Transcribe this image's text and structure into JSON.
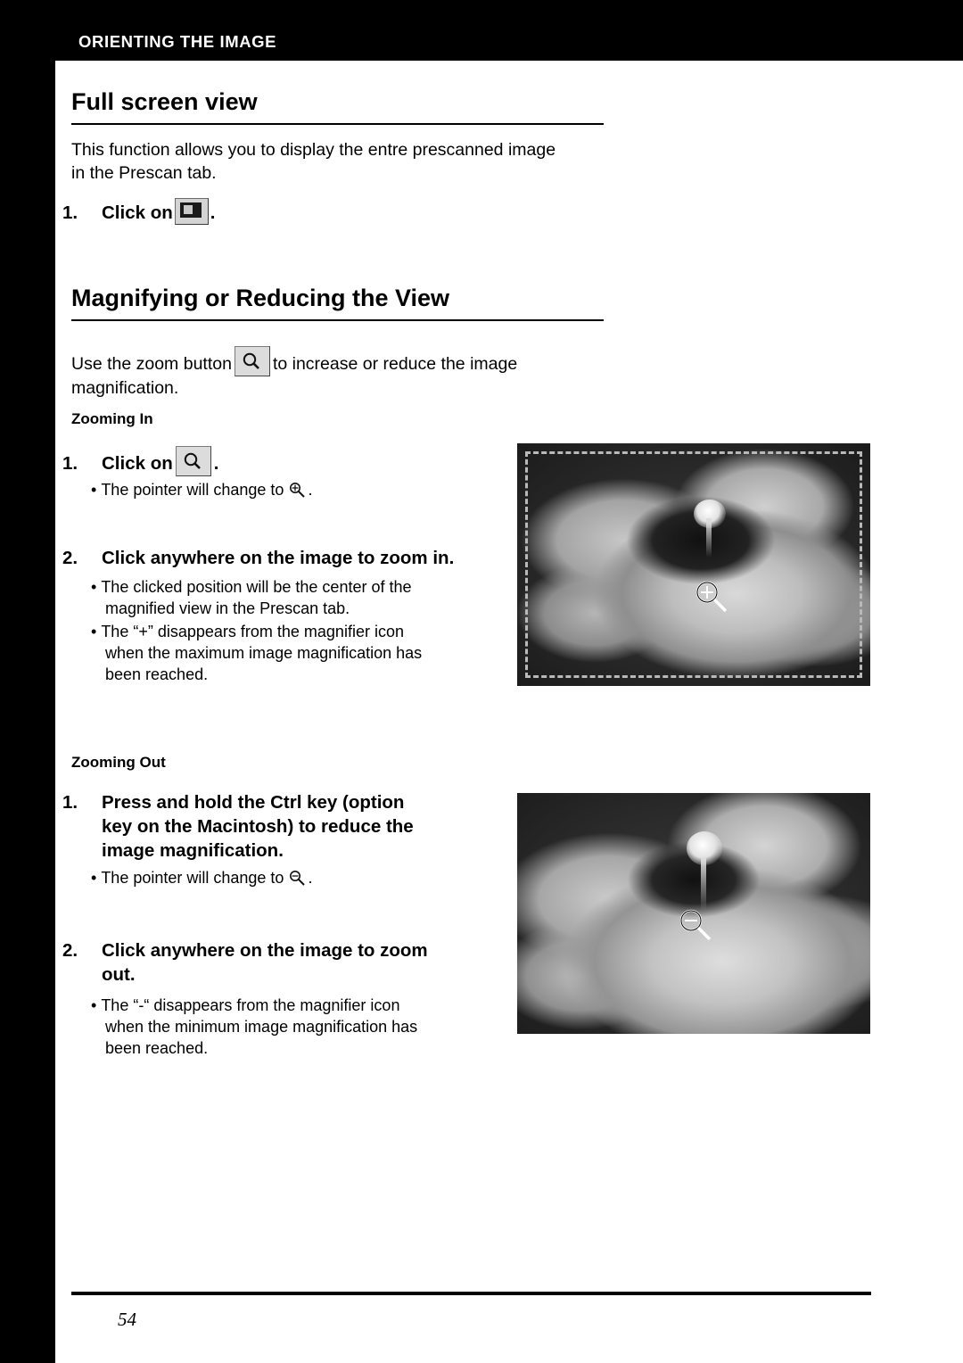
{
  "header": {
    "title": "ORIENTING THE IMAGE"
  },
  "sections": {
    "fullscreen": {
      "heading": "Full screen view",
      "intro_line1": "This function allows you to display the entre prescanned image",
      "intro_line2": "in the Prescan tab.",
      "step1_num": "1.",
      "step1_text": "Click on",
      "step1_after": ".",
      "button_icon": "fullscreen-button-icon"
    },
    "magnify": {
      "heading": "Magnifying or Reducing the View",
      "intro_before": "Use the zoom button",
      "intro_after": "to increase or reduce the image",
      "intro_line2": "magnification.",
      "button_icon": "zoom-button-icon"
    },
    "zooming_in": {
      "subhead": "Zooming In",
      "step1_num": "1.",
      "step1_text": "Click on",
      "step1_after": ".",
      "step1_bullet_before": "The pointer will change to",
      "step1_bullet_after": ".",
      "step2_num": "2.",
      "step2_text": "Click anywhere on the image to zoom in.",
      "bullet1_line1": "The clicked position will be the center of the",
      "bullet1_line2": "magnified view in the Prescan tab.",
      "bullet2_line1": "The “+” disappears from the magnifier icon",
      "bullet2_line2": "when the maximum image magnification has",
      "bullet2_line3": "been reached."
    },
    "zooming_out": {
      "subhead": "Zooming Out",
      "step1_num": "1.",
      "step1_line1": "Press and hold the Ctrl key (option",
      "step1_line2": "key on the Macintosh) to reduce the",
      "step1_line3": "image magnification.",
      "step1_bullet_before": "The pointer will change to",
      "step1_bullet_after": ".",
      "step2_num": "2.",
      "step2_line1": "Click anywhere on the image to zoom",
      "step2_line2": "out.",
      "bullet1_line1": "The “-“ disappears from the magnifier icon",
      "bullet1_line2": "when the minimum image magnification has",
      "bullet1_line3": "been reached."
    }
  },
  "figures": {
    "zoom_in_photo": "hibiscus-flower-prescan-zoomed-in",
    "zoom_out_photo": "hibiscus-flower-prescan-zoomed-out"
  },
  "footer": {
    "page_number": "54"
  },
  "colors": {
    "ink": "#000000",
    "paper": "#ffffff",
    "header_bar": "#000000",
    "header_text": "#ffffff"
  }
}
